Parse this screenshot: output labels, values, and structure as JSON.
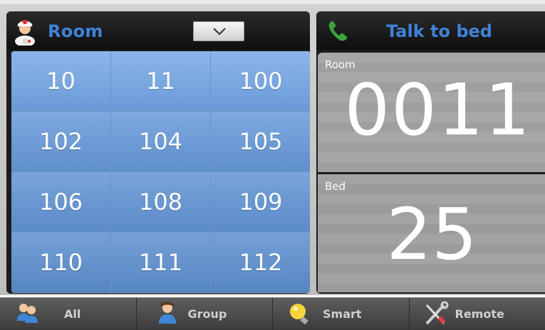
{
  "header": {
    "room_title": "Room",
    "talk_title": "Talk to bed"
  },
  "room_grid": [
    [
      "10",
      "11",
      "100"
    ],
    [
      "102",
      "104",
      "105"
    ],
    [
      "106",
      "108",
      "109"
    ],
    [
      "110",
      "111",
      "112"
    ]
  ],
  "detail": {
    "room_label": "Room",
    "room_value": "0011",
    "bed_label": "Bed",
    "bed_value": "25"
  },
  "nav": {
    "all_label": "All",
    "group_label": "Group",
    "smart_label": "Smart",
    "remote_label": "Remote"
  },
  "colors": {
    "title_blue": "#3f82d8",
    "grid_blue": "#7aa4db",
    "detail_gray": "#a5a5a5",
    "phone_green": "#3aa33a"
  },
  "icons": {
    "header_left": "nurse-icon",
    "dropdown": "chevron-down-icon",
    "header_right": "phone-icon",
    "nav_all": "users-icon",
    "nav_group": "user-icon",
    "nav_smart": "lightbulb-icon",
    "nav_remote": "tools-icon"
  }
}
